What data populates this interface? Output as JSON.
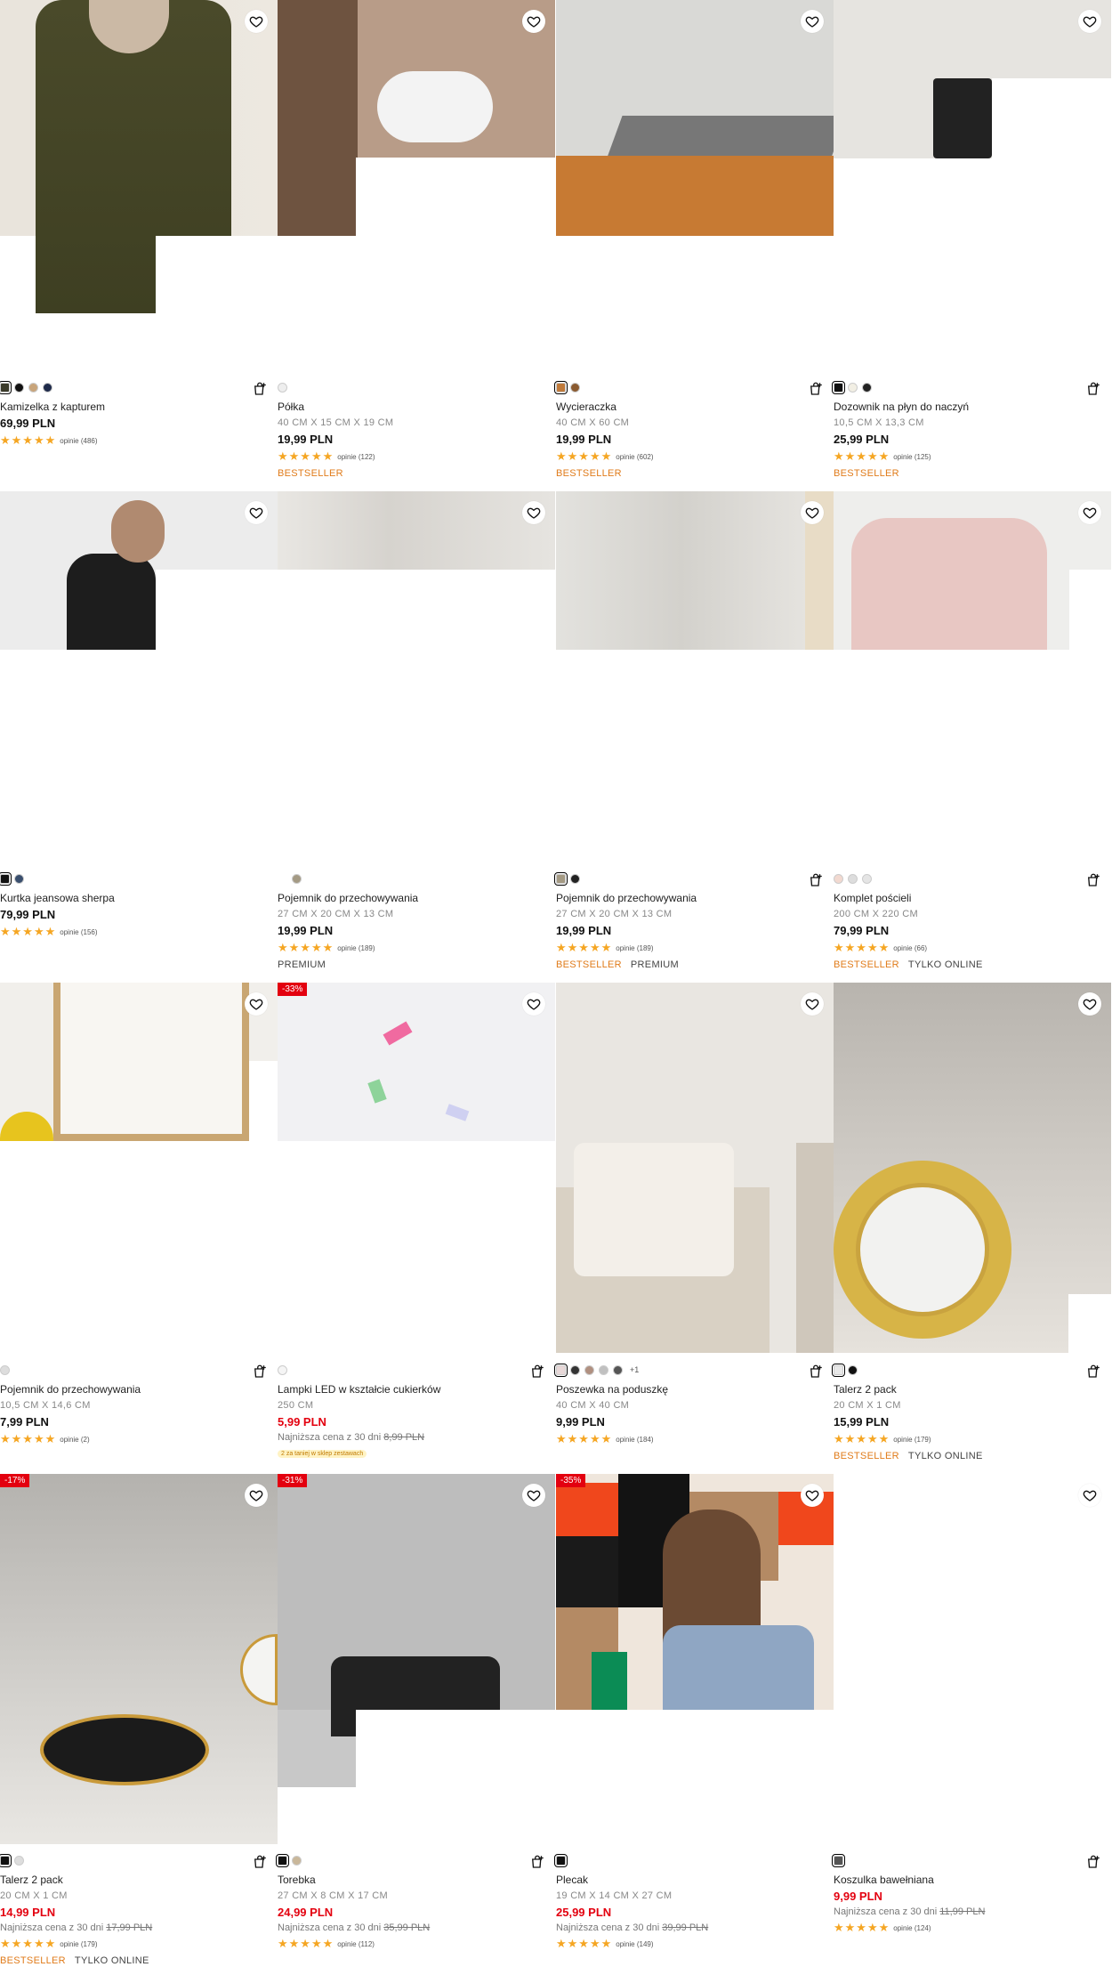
{
  "icons": {
    "favorite": "heart-outline-icon",
    "cart": "add-to-cart-icon"
  },
  "colors": {
    "accent_sale": "#e3000f",
    "bestseller": "#e07b1a",
    "stars": "#f5a623"
  },
  "products": [
    {
      "name": "Kamizelka z kapturem",
      "size": "",
      "price": "69,99 PLN",
      "rating_text": "opinie (486)",
      "stars": "★★★★★",
      "labels": [],
      "swatches": [
        "#3b3b2a",
        "#111111",
        "#c8a47a",
        "#1e2a4a"
      ]
    },
    {
      "name": "Półka",
      "size": "40 CM X 15 CM X 19 CM",
      "price": "19,99 PLN",
      "rating_text": "opinie (122)",
      "stars": "★★★★★",
      "labels": [
        "BESTSELLER"
      ],
      "swatches": [
        "#eeeeee"
      ]
    },
    {
      "name": "Wycieraczka",
      "size": "40 CM X 60 CM",
      "price": "19,99 PLN",
      "rating_text": "opinie (602)",
      "stars": "★★★★★",
      "labels": [
        "BESTSELLER"
      ],
      "swatches": [
        "#c07a3a",
        "#8a5a30"
      ]
    },
    {
      "name": "Dozownik na płyn do naczyń",
      "size": "10,5 CM X 13,3 CM",
      "price": "25,99 PLN",
      "rating_text": "opinie (125)",
      "stars": "★★★★★",
      "labels": [
        "BESTSELLER"
      ],
      "swatches": [
        "#111111",
        "#f2efe4",
        "#222222"
      ]
    },
    {
      "name": "Kurtka jeansowa sherpa",
      "size": "",
      "price": "79,99 PLN",
      "rating_text": "opinie (156)",
      "stars": "★★★★★",
      "labels": [],
      "swatches": [
        "#111111",
        "#3a4f6e"
      ]
    },
    {
      "name": "Pojemnik do przechowywania",
      "size": "27 CM X 20 CM X 13 CM",
      "price": "19,99 PLN",
      "rating_text": "opinie (189)",
      "stars": "★★★★★",
      "labels": [
        "PREMIUM"
      ],
      "swatches": [
        "#ffffff",
        "#a49a84"
      ]
    },
    {
      "name": "Pojemnik do przechowywania",
      "size": "27 CM X 20 CM X 13 CM",
      "price": "19,99 PLN",
      "rating_text": "opinie (189)",
      "stars": "★★★★★",
      "labels": [
        "BESTSELLER",
        "PREMIUM"
      ],
      "swatches": [
        "#a49a84",
        "#222222"
      ]
    },
    {
      "name": "Komplet pościeli",
      "size": "200 CM X 220 CM",
      "price": "79,99 PLN",
      "rating_text": "opinie (66)",
      "stars": "★★★★★",
      "labels": [
        "BESTSELLER",
        "TYLKO ONLINE"
      ],
      "swatches": [
        "#f2d9d0",
        "#dddddd",
        "#e5e5e5"
      ]
    },
    {
      "name": "Pojemnik do przechowywania",
      "size": "10,5 CM X 14,6 CM",
      "price": "7,99 PLN",
      "rating_text": "opinie (2)",
      "stars": "★★★★★",
      "labels": [],
      "swatches": [
        "#dddddd"
      ]
    },
    {
      "name": "Lampki LED w kształcie cukierków",
      "size": "250 CM",
      "price": "5,99 PLN",
      "sale": true,
      "lowest_label": "Najniższa cena z 30 dni",
      "lowest_price": "8,99 PLN",
      "cheaper_tag": "2 za taniej w sklep zestawach",
      "rating_text": "",
      "stars": "",
      "labels": [],
      "swatches": [
        "#f5f5f5"
      ],
      "discount": "-33%"
    },
    {
      "name": "Poszewka na poduszkę",
      "size": "40 CM X 40 CM",
      "price": "9,99 PLN",
      "rating_text": "opinie (184)",
      "stars": "★★★★★",
      "labels": [],
      "swatches": [
        "#e8d8d8",
        "#333333",
        "#b09080",
        "#c0c0c0",
        "#555555"
      ],
      "more": "+1"
    },
    {
      "name": "Talerz 2 pack",
      "size": "20 CM X 1 CM",
      "price": "15,99 PLN",
      "rating_text": "opinie (179)",
      "stars": "★★★★★",
      "labels": [
        "BESTSELLER",
        "TYLKO ONLINE"
      ],
      "swatches": [
        "#e8e8e8",
        "#111111"
      ]
    },
    {
      "name": "Talerz 2 pack",
      "size": "20 CM X 1 CM",
      "price": "14,99 PLN",
      "sale": true,
      "lowest_label": "Najniższa cena z 30 dni",
      "lowest_price": "17,99 PLN",
      "rating_text": "opinie (179)",
      "stars": "★★★★★",
      "labels": [
        "BESTSELLER",
        "TYLKO ONLINE"
      ],
      "swatches": [
        "#111111",
        "#dddddd"
      ],
      "discount": "-17%"
    },
    {
      "name": "Torebka",
      "size": "27 CM X 8 CM X 17 CM",
      "price": "24,99 PLN",
      "sale": true,
      "lowest_label": "Najniższa cena z 30 dni",
      "lowest_price": "35,99 PLN",
      "rating_text": "opinie (112)",
      "stars": "★★★★★",
      "labels": [],
      "swatches": [
        "#111111",
        "#c9b79a"
      ],
      "discount": "-31%"
    },
    {
      "name": "Plecak",
      "size": "19 CM X 14 CM X 27 CM",
      "price": "25,99 PLN",
      "sale": true,
      "lowest_label": "Najniższa cena z 30 dni",
      "lowest_price": "39,99 PLN",
      "rating_text": "opinie (149)",
      "stars": "★★★★★",
      "labels": [],
      "swatches": [
        "#111111"
      ],
      "discount": "-35%"
    },
    {
      "name": "Koszulka bawełniana",
      "size": "",
      "price": "9,99 PLN",
      "sale": true,
      "lowest_label": "Najniższa cena z 30 dni",
      "lowest_price": "11,99 PLN",
      "rating_text": "opinie (124)",
      "stars": "★★★★★",
      "labels": [],
      "swatches": [
        "#555555"
      ]
    }
  ]
}
